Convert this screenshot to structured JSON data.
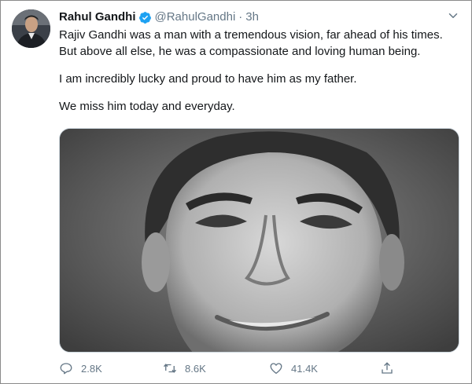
{
  "tweet": {
    "author_name": "Rahul Gandhi",
    "handle": "@RahulGandhi",
    "separator": "·",
    "time": "3h",
    "paragraphs": [
      "Rajiv Gandhi was a man with a tremendous vision, far ahead of his times. But above all else, he was a compassionate and loving human being.",
      "I am incredibly lucky and proud to have him as my father.",
      "We miss him today and everyday."
    ],
    "counts": {
      "replies": "2.8K",
      "retweets": "8.6K",
      "likes": "41.4K"
    }
  },
  "icons": {
    "verified": "verified-badge-icon",
    "more": "chevron-down-icon",
    "reply": "reply-icon",
    "retweet": "retweet-icon",
    "like": "heart-icon",
    "share": "share-icon"
  },
  "colors": {
    "text": "#14171a",
    "secondary": "#657786",
    "verified": "#1da1f2",
    "border": "#8a8a8a"
  }
}
